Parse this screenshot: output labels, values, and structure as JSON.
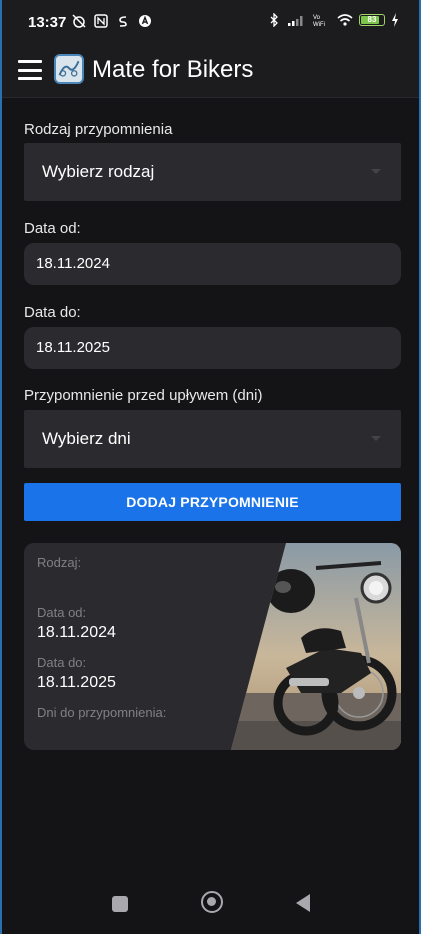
{
  "status_bar": {
    "time": "13:37",
    "battery": "83"
  },
  "app_bar": {
    "title": "Mate for Bikers"
  },
  "form": {
    "type_label": "Rodzaj przypomnienia",
    "type_value": "Wybierz rodzaj",
    "date_from_label": "Data od:",
    "date_from_value": "18.11.2024",
    "date_to_label": "Data do:",
    "date_to_value": "18.11.2025",
    "days_label": "Przypomnienie przed upływem (dni)",
    "days_value": "Wybierz dni",
    "add_button": "DODAJ PRZYPOMNIENIE"
  },
  "card": {
    "type_label": "Rodzaj:",
    "date_from_label": "Data od:",
    "date_from_value": "18.11.2024",
    "date_to_label": "Data do:",
    "date_to_value": "18.11.2025",
    "days_label": "Dni do przypomnienia:"
  },
  "colors": {
    "accent": "#1a73e8",
    "background": "#141416",
    "field": "#2b2b2f"
  }
}
